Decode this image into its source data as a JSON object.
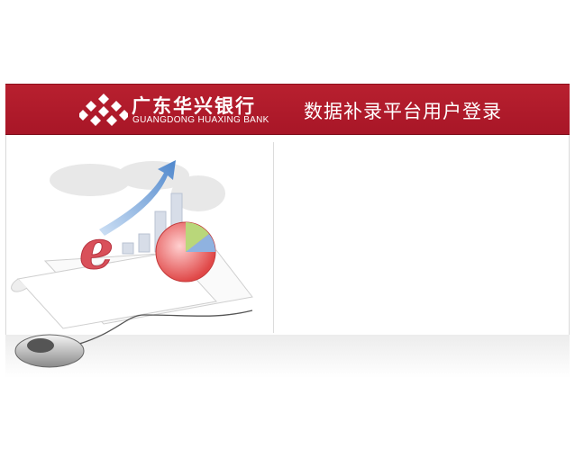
{
  "header": {
    "bank_name_cn": "广东华兴银行",
    "bank_name_en": "GUANGDONG HUAXING BANK",
    "platform_title": "数据补录平台用户登录"
  },
  "colors": {
    "header_red": "#b01d2d",
    "background": "#ffffff"
  },
  "illustration": {
    "icon": "ie-logo-chart-mouse"
  }
}
